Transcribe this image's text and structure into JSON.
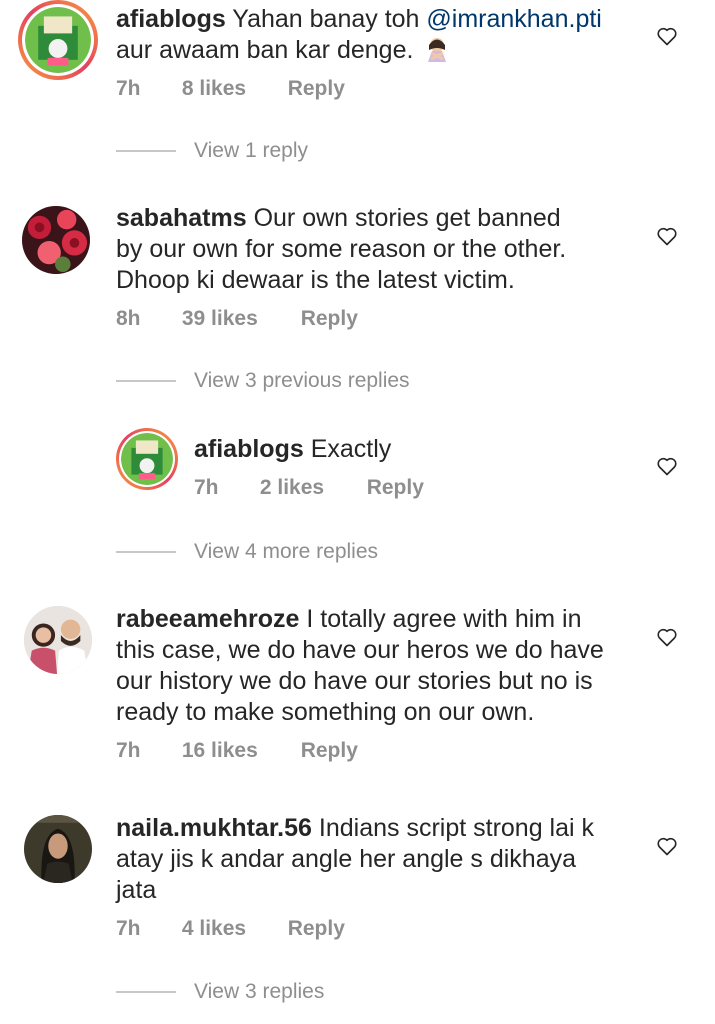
{
  "comments": [
    {
      "username": "afiablogs",
      "text": "Yahan banay toh ",
      "mention": "@imrankhan.pti",
      "text2": "aur awaam ban kar denge.",
      "emoji_icon": "woman-gesturing-no-emoji",
      "time": "7h",
      "likes": "8 likes",
      "reply": "Reply",
      "view_replies": "View 1 reply"
    },
    {
      "username": "sabahatms",
      "line1": "Our own stories get banned",
      "line2": "by our own for some reason or the other.",
      "line3": "Dhoop ki dewaar is the latest victim.",
      "time": "8h",
      "likes": "39 likes",
      "reply": "Reply",
      "view_replies": "View 3 previous replies"
    },
    {
      "username": "afiablogs",
      "text": "Exactly",
      "time": "7h",
      "likes": "2 likes",
      "reply": "Reply",
      "view_replies": "View 4 more replies"
    },
    {
      "username": "rabeeamehroze",
      "line1": "I totally agree with him in",
      "line2": "this case, we do have our heros we do have",
      "line3": "our history we do have our stories but no is",
      "line4": "ready to make something on our own.",
      "time": "7h",
      "likes": "16 likes",
      "reply": "Reply"
    },
    {
      "username": "naila.mukhtar.56",
      "line1": "Indians script strong lai k",
      "line2": "atay jis k andar angle her angle s dikhaya",
      "line3": "jata",
      "time": "7h",
      "likes": "4 likes",
      "reply": "Reply",
      "view_replies": "View 3 replies"
    }
  ],
  "icons": {
    "like": "heart-outline-icon"
  },
  "colors": {
    "text": "#262626",
    "meta": "#8e8e8e",
    "mention": "#00376b",
    "ring_from": "#f9a03f",
    "ring_to": "#e4405f"
  }
}
